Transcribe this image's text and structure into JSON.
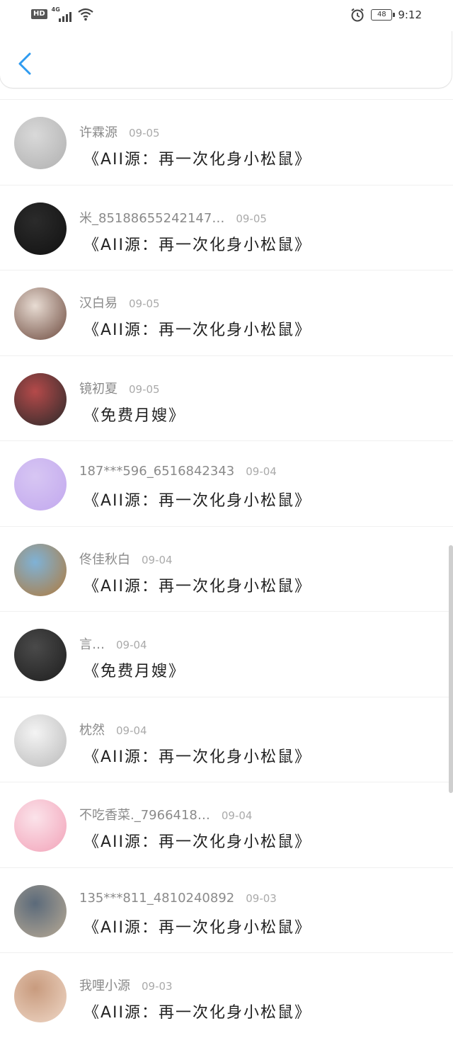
{
  "status_bar": {
    "hd": "HD",
    "network": "4G",
    "battery": "48",
    "time": "9:12",
    "icons": [
      "signal-icon",
      "wifi-icon",
      "alarm-icon",
      "battery-icon"
    ]
  },
  "header": {
    "back_icon": "chevron-left-icon",
    "accent_color": "#2f9bf0"
  },
  "items": [
    {
      "name": "许霖源",
      "date": "09-05",
      "comment": "《AII源：再一次化身小松鼠》",
      "avatar_colors": [
        "#d9d9d9",
        "#b0b0b0"
      ]
    },
    {
      "name": "米_85188655242147…",
      "date": "09-05",
      "comment": "《AII源：再一次化身小松鼠》",
      "avatar_colors": [
        "#2b2b2b",
        "#111111"
      ]
    },
    {
      "name": "汉白易",
      "date": "09-05",
      "comment": "《AII源：再一次化身小松鼠》",
      "avatar_colors": [
        "#e8dcd3",
        "#6d4a3e"
      ]
    },
    {
      "name": "镜初夏",
      "date": "09-05",
      "comment": "《免费月嫂》",
      "avatar_colors": [
        "#b54a4a",
        "#2a2a2a"
      ]
    },
    {
      "name": "187***596_6516842343",
      "date": "09-04",
      "comment": "《AII源：再一次化身小松鼠》",
      "avatar_colors": [
        "#d7c6f3",
        "#c2a8ee"
      ]
    },
    {
      "name": "佟佳秋白",
      "date": "09-04",
      "comment": "《AII源：再一次化身小松鼠》",
      "avatar_colors": [
        "#7fb2d6",
        "#b07a3c"
      ]
    },
    {
      "name": "言…",
      "date": "09-04",
      "comment": "《免费月嫂》",
      "avatar_colors": [
        "#4a4a4a",
        "#1e1e1e"
      ]
    },
    {
      "name": "枕然",
      "date": "09-04",
      "comment": "《AII源：再一次化身小松鼠》",
      "avatar_colors": [
        "#f4f4f4",
        "#bbbbbb"
      ]
    },
    {
      "name": "不吃香菜._7966418…",
      "date": "09-04",
      "comment": "《AII源：再一次化身小松鼠》",
      "avatar_colors": [
        "#fbe3ea",
        "#f2a2b8"
      ]
    },
    {
      "name": "135***811_4810240892",
      "date": "09-03",
      "comment": "《AII源：再一次化身小松鼠》",
      "avatar_colors": [
        "#5b6a7a",
        "#b8aa95"
      ]
    },
    {
      "name": "我哩小源",
      "date": "09-03",
      "comment": "《AII源：再一次化身小松鼠》",
      "avatar_colors": [
        "#c89b7e",
        "#efd7c6"
      ]
    }
  ]
}
